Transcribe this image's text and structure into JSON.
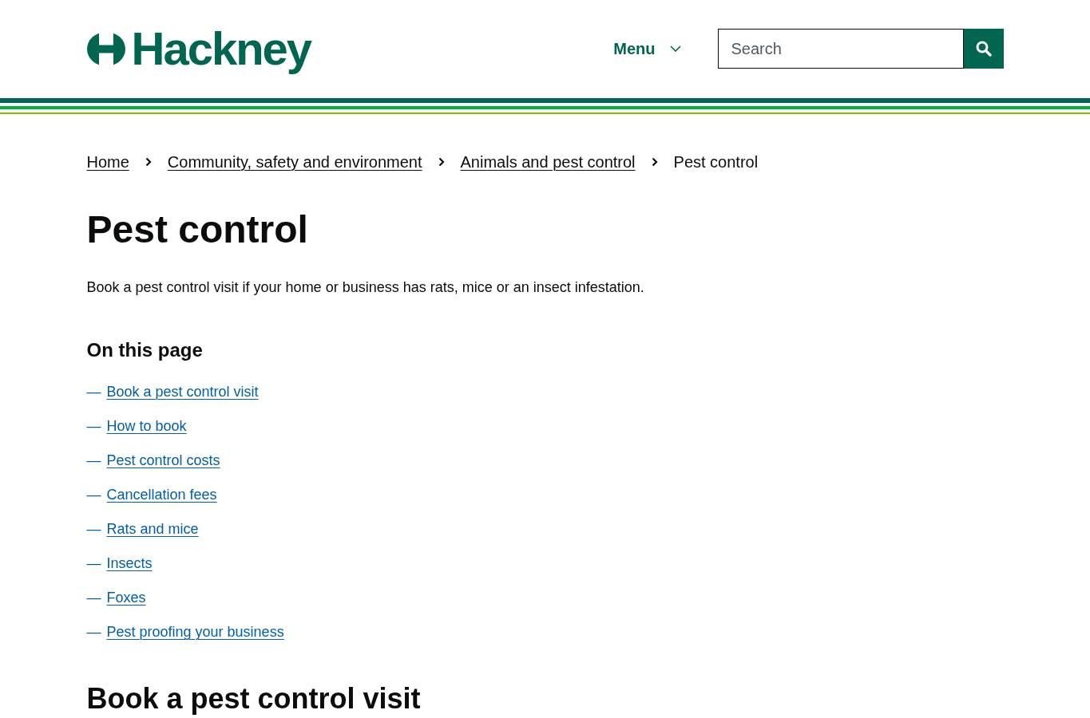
{
  "header": {
    "logo": {
      "text": "Hackney"
    },
    "menu": {
      "label": "Menu",
      "expanded": false
    },
    "search": {
      "placeholder": "Search"
    }
  },
  "breadcrumbs": [
    {
      "label": "Home",
      "current": false
    },
    {
      "label": "Community, safety and environment",
      "current": false
    },
    {
      "label": "Animals and pest control",
      "current": false
    },
    {
      "label": "Pest control",
      "current": true
    }
  ],
  "page": {
    "title": "Pest control",
    "intro": "Book a pest control visit if your home or business has rats, mice or an insect infestation."
  },
  "contents": {
    "heading": "On this page",
    "items": [
      {
        "marker": "—",
        "label": "Book a pest control visit"
      },
      {
        "marker": "—",
        "label": "How to book"
      },
      {
        "marker": "—",
        "label": "Pest control costs"
      },
      {
        "marker": "—",
        "label": "Cancellation fees"
      },
      {
        "marker": "—",
        "label": "Rats and mice"
      },
      {
        "marker": "—",
        "label": "Insects"
      },
      {
        "marker": "—",
        "label": "Foxes"
      },
      {
        "marker": "—",
        "label": "Pest proofing your business"
      }
    ]
  },
  "sections": [
    {
      "heading": "Book a pest control visit"
    }
  ]
}
